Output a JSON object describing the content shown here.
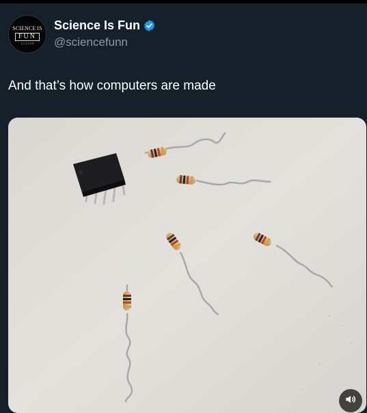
{
  "tweet": {
    "author": {
      "display_name": "Science Is Fun",
      "handle": "@sciencefunn",
      "verified": true,
      "avatar": {
        "logo_top": "SCIENCE IS",
        "logo_box": "FUN",
        "logo_digits": "1·1·2·3·5·8"
      }
    },
    "text": "And that’s how computers are made",
    "media": {
      "type": "video",
      "icons": [
        "speaker-icon"
      ]
    }
  },
  "colors": {
    "background": "#15202b",
    "verified_badge": "#1d9bf0",
    "handle_text": "#8b98a5"
  }
}
